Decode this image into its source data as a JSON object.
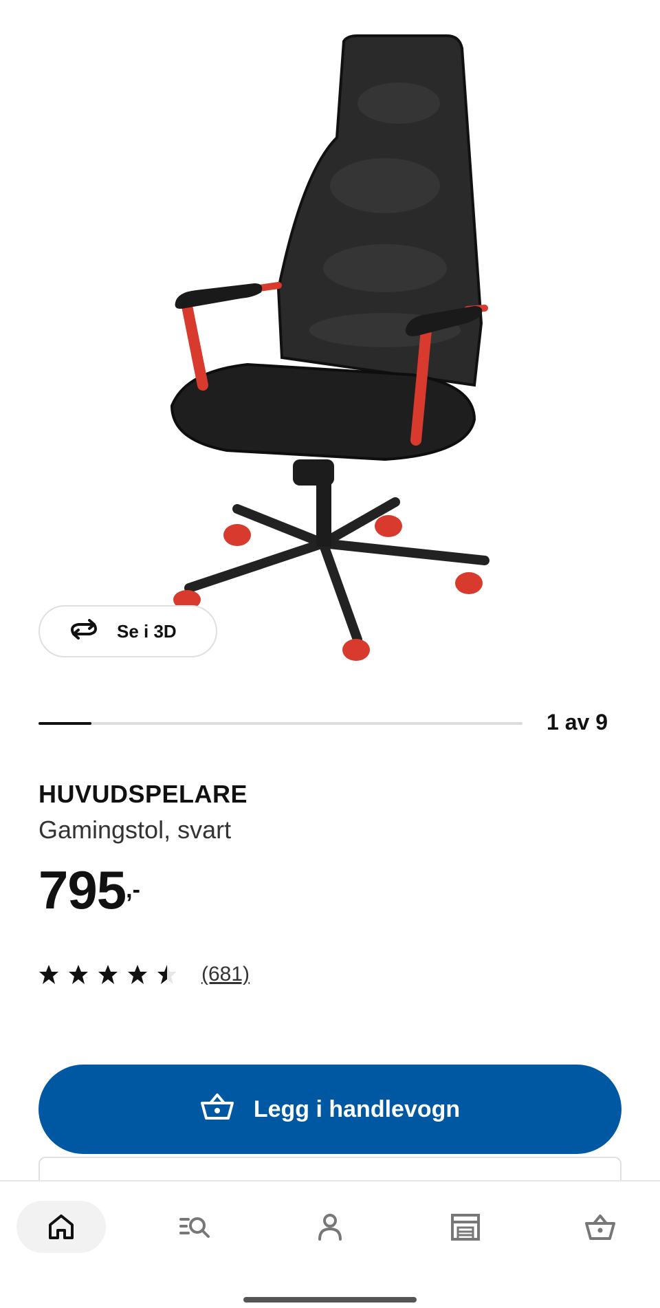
{
  "view3d": {
    "label": "Se i 3D"
  },
  "gallery": {
    "counter": "1 av 9",
    "progress": 0.11
  },
  "product": {
    "name": "HUVUDSPELARE",
    "description": "Gamingstol, svart",
    "price": "795",
    "price_suffix": ",-",
    "rating": 4.5,
    "reviews": "(681)"
  },
  "cart_button": {
    "label": "Legg i handlevogn"
  },
  "nav": {
    "items": [
      {
        "icon": "home-icon",
        "active": true
      },
      {
        "icon": "search-list-icon",
        "active": false
      },
      {
        "icon": "profile-icon",
        "active": false
      },
      {
        "icon": "store-icon",
        "active": false
      },
      {
        "icon": "cart-icon",
        "active": false
      }
    ]
  },
  "colors": {
    "primary": "#0058a3",
    "accent_red": "#d83a2e",
    "text": "#111111"
  }
}
